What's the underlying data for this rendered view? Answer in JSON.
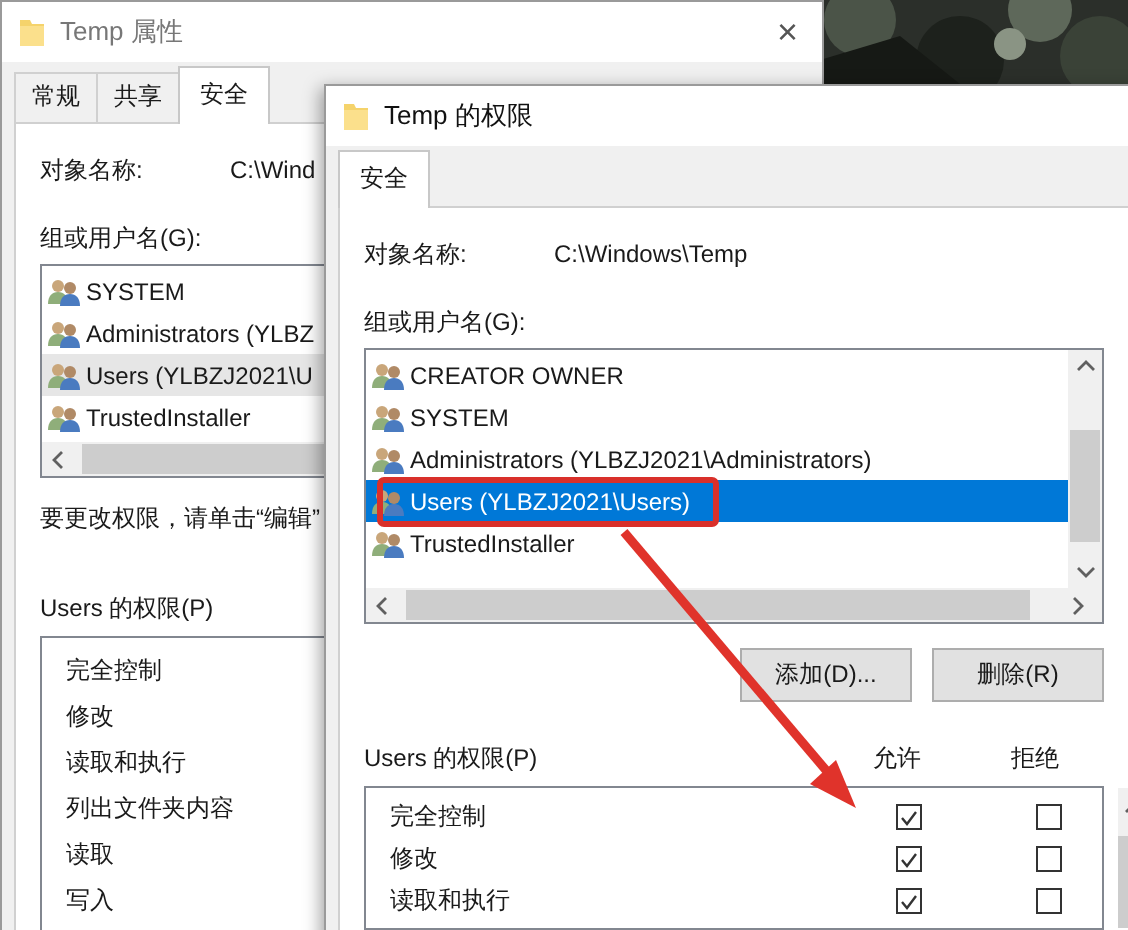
{
  "back_dialog": {
    "title": "Temp 属性",
    "close": "×",
    "tabs": [
      {
        "label": "常规",
        "selected": false
      },
      {
        "label": "共享",
        "selected": false
      },
      {
        "label": "安全",
        "selected": true
      }
    ],
    "object_label": "对象名称:",
    "object_value": "C:\\Wind",
    "group_label": "组或用户名(G):",
    "users": [
      {
        "name": "SYSTEM",
        "selected": false
      },
      {
        "name": "Administrators (YLBZ",
        "selected": false
      },
      {
        "name": "Users (YLBZJ2021\\U",
        "selected": true
      },
      {
        "name": "TrustedInstaller",
        "selected": false
      }
    ],
    "hint": "要更改权限，请单击“编辑”",
    "perm_label": "Users 的权限(P)",
    "permissions": [
      "完全控制",
      "修改",
      "读取和执行",
      "列出文件夹内容",
      "读取",
      "写入"
    ]
  },
  "front_dialog": {
    "title": "Temp 的权限",
    "tabs": [
      {
        "label": "安全",
        "selected": true
      }
    ],
    "object_label": "对象名称:",
    "object_value": "C:\\Windows\\Temp",
    "group_label": "组或用户名(G):",
    "users": [
      {
        "name": "CREATOR OWNER",
        "selected": false
      },
      {
        "name": "SYSTEM",
        "selected": false
      },
      {
        "name": "Administrators (YLBZJ2021\\Administrators)",
        "selected": false
      },
      {
        "name": "Users (YLBZJ2021\\Users)",
        "selected": true
      },
      {
        "name": "TrustedInstaller",
        "selected": false
      }
    ],
    "buttons": [
      "添加(D)...",
      "删除(R)"
    ],
    "perm_label": "Users 的权限(P)",
    "columns": [
      "允许",
      "拒绝"
    ],
    "permissions": [
      {
        "name": "完全控制",
        "allow": true,
        "deny": false
      },
      {
        "name": "修改",
        "allow": true,
        "deny": false
      },
      {
        "name": "读取和执行",
        "allow": true,
        "deny": false
      }
    ]
  }
}
